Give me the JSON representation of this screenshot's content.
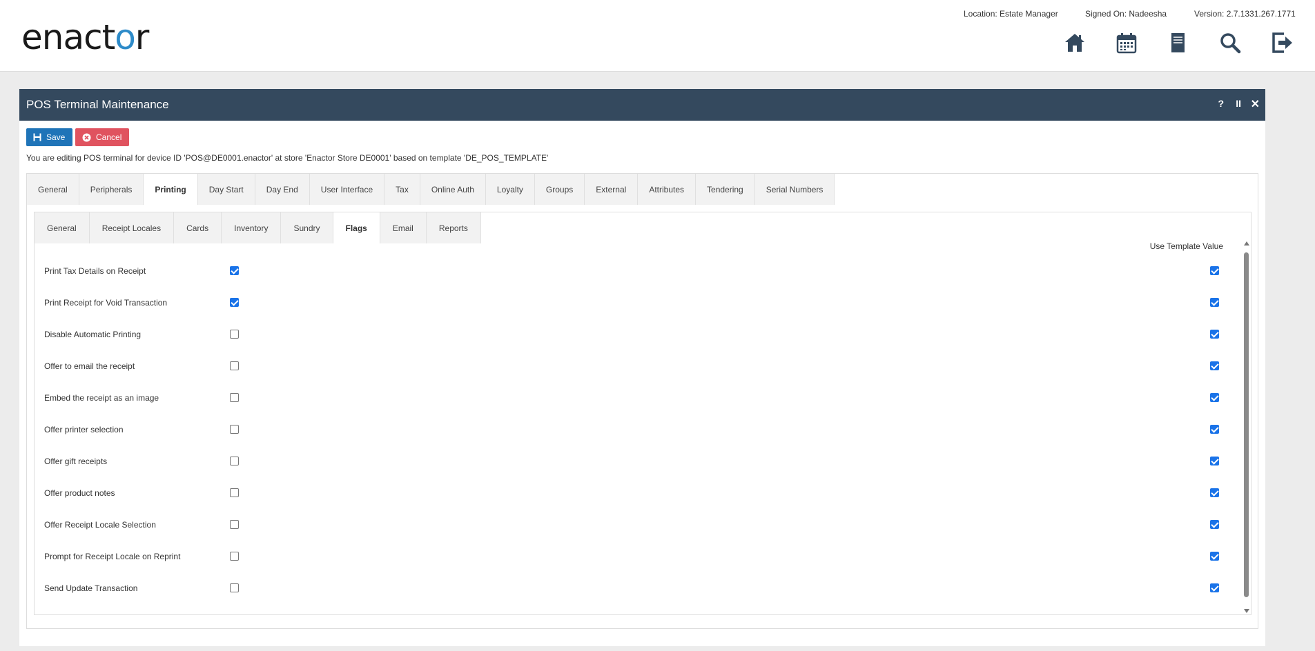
{
  "header": {
    "logo_text_pre": "enact",
    "logo_text_o": "o",
    "logo_text_post": "r",
    "location": "Location: Estate Manager",
    "signed_on": "Signed On: Nadeesha",
    "version": "Version: 2.7.1331.267.1771",
    "icons": [
      "home-icon",
      "calendar-icon",
      "document-icon",
      "search-icon",
      "logout-icon"
    ]
  },
  "window": {
    "title": "POS Terminal Maintenance",
    "help": "?",
    "pause": "II",
    "close": "✕",
    "save_label": "Save",
    "cancel_label": "Cancel",
    "info": "You are editing POS terminal for device ID 'POS@DE0001.enactor' at store 'Enactor Store DE0001' based on template 'DE_POS_TEMPLATE'"
  },
  "tabs": [
    {
      "label": "General"
    },
    {
      "label": "Peripherals"
    },
    {
      "label": "Printing",
      "active": true
    },
    {
      "label": "Day Start"
    },
    {
      "label": "Day End"
    },
    {
      "label": "User Interface"
    },
    {
      "label": "Tax"
    },
    {
      "label": "Online Auth"
    },
    {
      "label": "Loyalty"
    },
    {
      "label": "Groups"
    },
    {
      "label": "External"
    },
    {
      "label": "Attributes"
    },
    {
      "label": "Tendering"
    },
    {
      "label": "Serial Numbers"
    }
  ],
  "subtabs": [
    {
      "label": "General"
    },
    {
      "label": "Receipt Locales"
    },
    {
      "label": "Cards"
    },
    {
      "label": "Inventory"
    },
    {
      "label": "Sundry"
    },
    {
      "label": "Flags",
      "active": true
    },
    {
      "label": "Email"
    },
    {
      "label": "Reports"
    }
  ],
  "flags": {
    "use_template_header": "Use Template Value",
    "rows": [
      {
        "label": "Print Tax Details on Receipt",
        "value": true,
        "use_template": true
      },
      {
        "label": "Print Receipt for Void Transaction",
        "value": true,
        "use_template": true
      },
      {
        "label": "Disable Automatic Printing",
        "value": false,
        "use_template": true
      },
      {
        "label": "Offer to email the receipt",
        "value": false,
        "use_template": true
      },
      {
        "label": "Embed the receipt as an image",
        "value": false,
        "use_template": true
      },
      {
        "label": "Offer printer selection",
        "value": false,
        "use_template": true
      },
      {
        "label": "Offer gift receipts",
        "value": false,
        "use_template": true
      },
      {
        "label": "Offer product notes",
        "value": false,
        "use_template": true
      },
      {
        "label": "Offer Receipt Locale Selection",
        "value": false,
        "use_template": true
      },
      {
        "label": "Prompt for Receipt Locale on Reprint",
        "value": false,
        "use_template": true
      },
      {
        "label": "Send Update Transaction",
        "value": false,
        "use_template": true
      }
    ]
  },
  "colors": {
    "titlebar": "#34495e",
    "save": "#1f74b8",
    "cancel": "#e0535f",
    "logo_accent": "#2e8bc9",
    "checkbox": "#1a73e8"
  }
}
